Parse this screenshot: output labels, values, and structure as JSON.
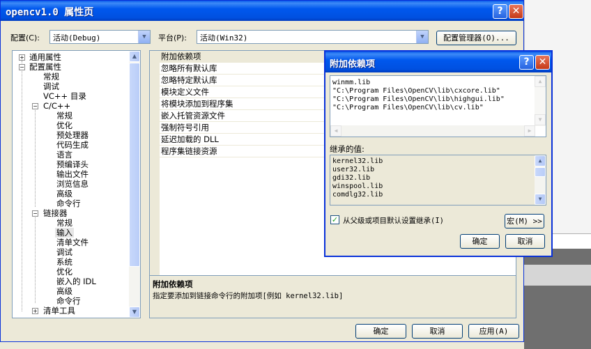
{
  "window": {
    "title": "opencv1.0 属性页",
    "help_glyph": "?",
    "close_glyph": "✕"
  },
  "toolbar": {
    "config_label": "配置(C):",
    "config_value": "活动(Debug)",
    "platform_label": "平台(P):",
    "platform_value": "活动(Win32)",
    "config_manager_button": "配置管理器(O)..."
  },
  "tree": {
    "items": [
      {
        "label": "通用属性",
        "expander": "+"
      },
      {
        "label": "配置属性",
        "expander": "−"
      },
      {
        "label": "常规"
      },
      {
        "label": "调试"
      },
      {
        "label": "VC++ 目录"
      },
      {
        "label": "C/C++",
        "expander": "−"
      },
      {
        "label": "常规"
      },
      {
        "label": "优化"
      },
      {
        "label": "预处理器"
      },
      {
        "label": "代码生成"
      },
      {
        "label": "语言"
      },
      {
        "label": "预编译头"
      },
      {
        "label": "输出文件"
      },
      {
        "label": "浏览信息"
      },
      {
        "label": "高级"
      },
      {
        "label": "命令行"
      },
      {
        "label": "链接器",
        "expander": "−"
      },
      {
        "label": "常规"
      },
      {
        "label": "输入",
        "selected": true
      },
      {
        "label": "清单文件"
      },
      {
        "label": "调试"
      },
      {
        "label": "系统"
      },
      {
        "label": "优化"
      },
      {
        "label": "嵌入的 IDL"
      },
      {
        "label": "高级"
      },
      {
        "label": "命令行"
      },
      {
        "label": "清单工具",
        "expander": "+"
      }
    ]
  },
  "properties": {
    "rows": [
      "附加依赖项",
      "忽略所有默认库",
      "忽略特定默认库",
      "模块定义文件",
      "将模块添加到程序集",
      "嵌入托管资源文件",
      "强制符号引用",
      "延迟加载的 DLL",
      "程序集链接资源"
    ],
    "description_title": "附加依赖项",
    "description_text": "指定要添加到链接命令行的附加项[例如 kernel32.lib]"
  },
  "footer": {
    "ok_button": "确定",
    "cancel_button": "取消",
    "apply_button": "应用(A)"
  },
  "dialog": {
    "title": "附加依赖项",
    "lines": [
      "winmm.lib",
      "\"C:\\Program Files\\OpenCV\\lib\\cxcore.lib\"",
      "\"C:\\Program Files\\OpenCV\\lib\\highgui.lib\"",
      "\"C:\\Program Files\\OpenCV\\lib\\cv.lib\""
    ],
    "inherited_label": "继承的值:",
    "inherited_values": [
      "kernel32.lib",
      "user32.lib",
      "gdi32.lib",
      "winspool.lib",
      "comdlg32.lib"
    ],
    "inherit_checkbox_label": "从父级或项目默认设置继承(I)",
    "inherit_checked": true,
    "macro_button": "宏(M) >>",
    "ok_button": "确定",
    "cancel_button": "取消"
  }
}
